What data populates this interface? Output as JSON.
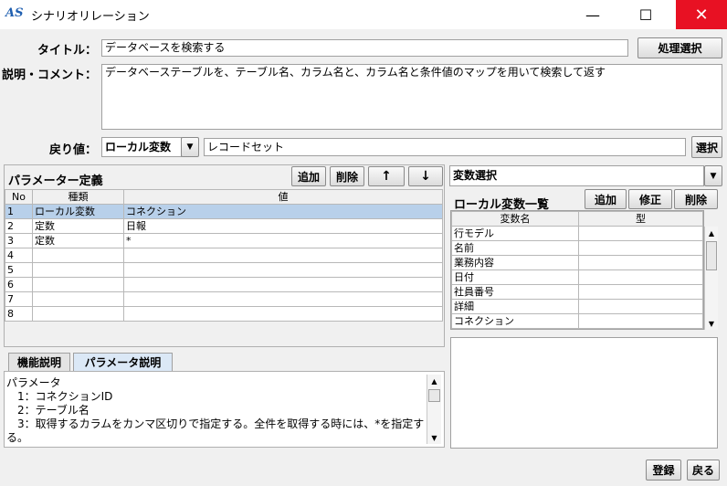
{
  "window": {
    "logo": "AS",
    "title": "シナリオリレーション",
    "minimize": "—",
    "maximize": "☐",
    "close": "✕"
  },
  "form": {
    "title_label": "タイトル：",
    "title_value": "データベースを検索する",
    "process_select": "処理選択",
    "desc_label": "説明・コメント：",
    "desc_value": "データベーステーブルを、テーブル名、カラム名と、カラム名と条件値のマップを用いて検索して返す",
    "return_label": "戻り値：",
    "return_type": "ローカル変数",
    "return_value": "レコードセット",
    "select_button": "選択"
  },
  "params": {
    "title": "パラメーター定義",
    "add": "追加",
    "delete": "削除",
    "up": "↑",
    "down": "↓",
    "columns": [
      "No",
      "種類",
      "値"
    ],
    "rows": [
      [
        "1",
        "ローカル変数",
        "コネクション"
      ],
      [
        "2",
        "定数",
        "日報"
      ],
      [
        "3",
        "定数",
        "*"
      ],
      [
        "4",
        "",
        ""
      ],
      [
        "5",
        "",
        ""
      ],
      [
        "6",
        "",
        ""
      ],
      [
        "7",
        "",
        ""
      ],
      [
        "8",
        "",
        ""
      ]
    ]
  },
  "tabs": {
    "function_desc": "機能説明",
    "param_desc": "パラメータ説明"
  },
  "param_description": {
    "lines": [
      "パラメータ",
      "  1：コネクションID",
      "  2：テーブル名",
      "  3：取得するカラムをカンマ区切りで指定する。全件を取得する時には、*を指定す",
      "る。"
    ]
  },
  "variables": {
    "select_label": "変数選択",
    "list_title": "ローカル変数一覧",
    "add": "追加",
    "edit": "修正",
    "delete": "削除",
    "columns": [
      "変数名",
      "型"
    ],
    "rows": [
      [
        "行モデル",
        ""
      ],
      [
        "名前",
        ""
      ],
      [
        "業務内容",
        ""
      ],
      [
        "日付",
        ""
      ],
      [
        "社員番号",
        ""
      ],
      [
        "詳細",
        ""
      ],
      [
        "コネクション",
        ""
      ]
    ]
  },
  "footer": {
    "register": "登録",
    "back": "戻る"
  }
}
